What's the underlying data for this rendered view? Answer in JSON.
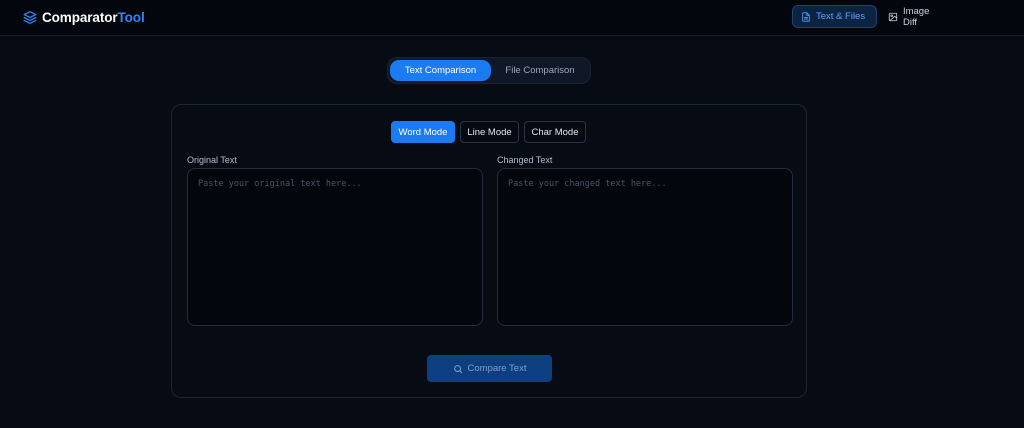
{
  "brand": {
    "name": "Comparator",
    "accent": "Tool",
    "icon": "layers-icon"
  },
  "nav": {
    "text_files": {
      "label": "Text & Files",
      "icon": "document-icon",
      "active": true
    },
    "image_diff": {
      "label": "Image Diff",
      "icon": "image-icon",
      "active": false
    }
  },
  "tabs": {
    "text_comparison": {
      "label": "Text Comparison",
      "active": true
    },
    "file_comparison": {
      "label": "File Comparison",
      "active": false
    }
  },
  "modes": {
    "word": {
      "label": "Word Mode",
      "active": true
    },
    "line": {
      "label": "Line Mode",
      "active": false
    },
    "char": {
      "label": "Char Mode",
      "active": false
    }
  },
  "original": {
    "label": "Original Text",
    "value": "",
    "placeholder": "Paste your original text here..."
  },
  "changed": {
    "label": "Changed Text",
    "value": "",
    "placeholder": "Paste your changed text here..."
  },
  "compare": {
    "label": "Compare Text",
    "icon": "search-icon",
    "enabled": false
  },
  "colors": {
    "background": "#070b14",
    "topbar": "#03060c",
    "accent": "#1b7bf2",
    "brand_accent": "#2f86ff",
    "disabled_button": "#0d3f80"
  }
}
